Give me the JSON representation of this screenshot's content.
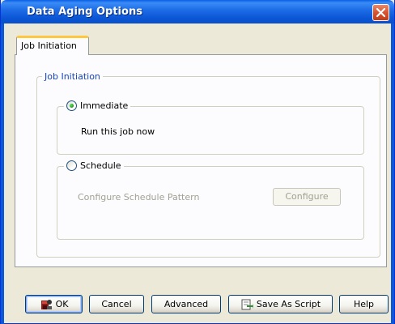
{
  "window": {
    "title": "Data Aging Options"
  },
  "tabs": [
    {
      "label": "Job Initiation"
    }
  ],
  "job_initiation": {
    "group_title": "Job Initiation",
    "immediate": {
      "label": "Immediate",
      "checked": true,
      "description": "Run this job now"
    },
    "schedule": {
      "label": "Schedule",
      "checked": false,
      "pattern_label": "Configure Schedule Pattern",
      "configure_button": "Configure"
    }
  },
  "buttons": {
    "ok": "OK",
    "cancel": "Cancel",
    "advanced": "Advanced",
    "save_as_script": "Save As Script",
    "help": "Help"
  },
  "icons": {
    "close": "close-icon",
    "ok": "ok-icon",
    "save_script": "save-script-icon"
  }
}
